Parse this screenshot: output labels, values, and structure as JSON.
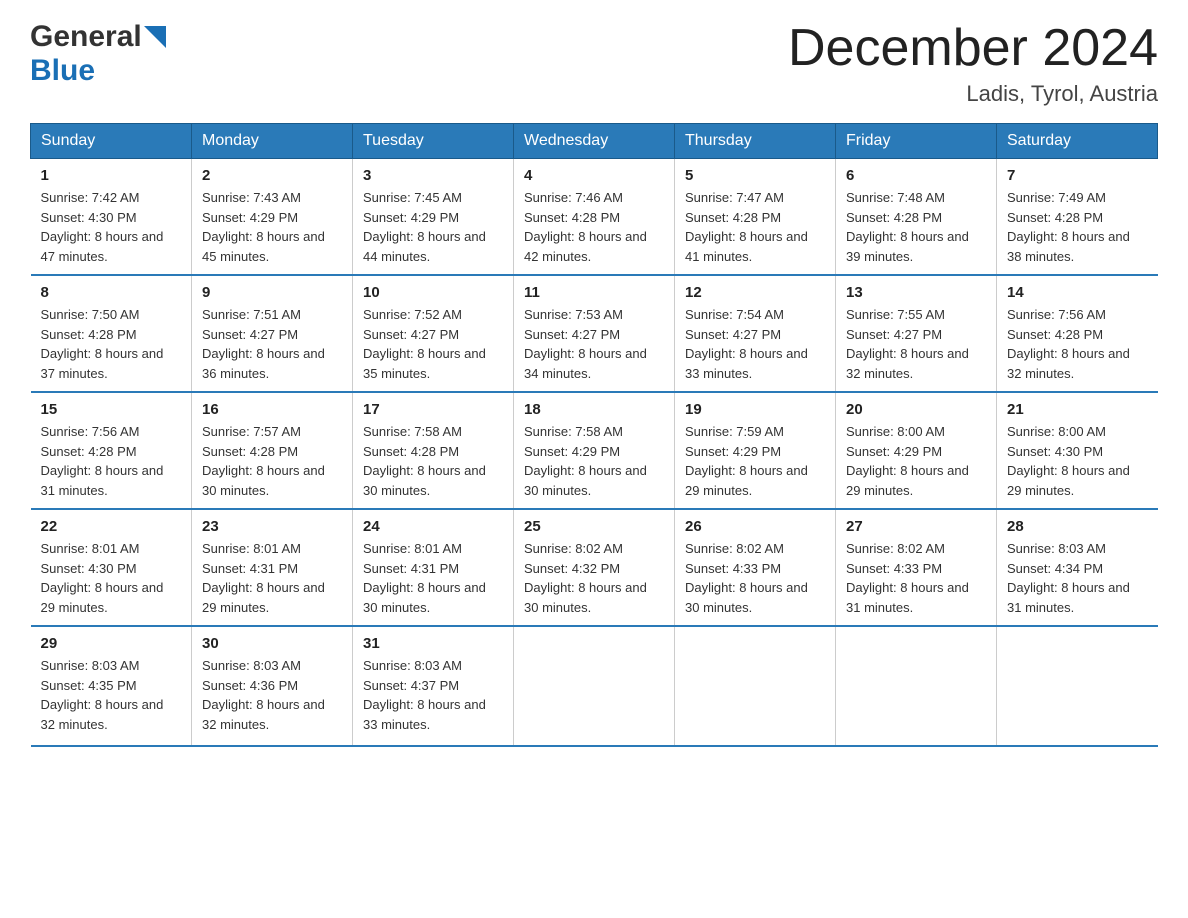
{
  "logo": {
    "general": "General",
    "blue": "Blue"
  },
  "title": "December 2024",
  "subtitle": "Ladis, Tyrol, Austria",
  "weekdays": [
    "Sunday",
    "Monday",
    "Tuesday",
    "Wednesday",
    "Thursday",
    "Friday",
    "Saturday"
  ],
  "weeks": [
    [
      {
        "day": "1",
        "sunrise": "7:42 AM",
        "sunset": "4:30 PM",
        "daylight": "8 hours and 47 minutes."
      },
      {
        "day": "2",
        "sunrise": "7:43 AM",
        "sunset": "4:29 PM",
        "daylight": "8 hours and 45 minutes."
      },
      {
        "day": "3",
        "sunrise": "7:45 AM",
        "sunset": "4:29 PM",
        "daylight": "8 hours and 44 minutes."
      },
      {
        "day": "4",
        "sunrise": "7:46 AM",
        "sunset": "4:28 PM",
        "daylight": "8 hours and 42 minutes."
      },
      {
        "day": "5",
        "sunrise": "7:47 AM",
        "sunset": "4:28 PM",
        "daylight": "8 hours and 41 minutes."
      },
      {
        "day": "6",
        "sunrise": "7:48 AM",
        "sunset": "4:28 PM",
        "daylight": "8 hours and 39 minutes."
      },
      {
        "day": "7",
        "sunrise": "7:49 AM",
        "sunset": "4:28 PM",
        "daylight": "8 hours and 38 minutes."
      }
    ],
    [
      {
        "day": "8",
        "sunrise": "7:50 AM",
        "sunset": "4:28 PM",
        "daylight": "8 hours and 37 minutes."
      },
      {
        "day": "9",
        "sunrise": "7:51 AM",
        "sunset": "4:27 PM",
        "daylight": "8 hours and 36 minutes."
      },
      {
        "day": "10",
        "sunrise": "7:52 AM",
        "sunset": "4:27 PM",
        "daylight": "8 hours and 35 minutes."
      },
      {
        "day": "11",
        "sunrise": "7:53 AM",
        "sunset": "4:27 PM",
        "daylight": "8 hours and 34 minutes."
      },
      {
        "day": "12",
        "sunrise": "7:54 AM",
        "sunset": "4:27 PM",
        "daylight": "8 hours and 33 minutes."
      },
      {
        "day": "13",
        "sunrise": "7:55 AM",
        "sunset": "4:27 PM",
        "daylight": "8 hours and 32 minutes."
      },
      {
        "day": "14",
        "sunrise": "7:56 AM",
        "sunset": "4:28 PM",
        "daylight": "8 hours and 32 minutes."
      }
    ],
    [
      {
        "day": "15",
        "sunrise": "7:56 AM",
        "sunset": "4:28 PM",
        "daylight": "8 hours and 31 minutes."
      },
      {
        "day": "16",
        "sunrise": "7:57 AM",
        "sunset": "4:28 PM",
        "daylight": "8 hours and 30 minutes."
      },
      {
        "day": "17",
        "sunrise": "7:58 AM",
        "sunset": "4:28 PM",
        "daylight": "8 hours and 30 minutes."
      },
      {
        "day": "18",
        "sunrise": "7:58 AM",
        "sunset": "4:29 PM",
        "daylight": "8 hours and 30 minutes."
      },
      {
        "day": "19",
        "sunrise": "7:59 AM",
        "sunset": "4:29 PM",
        "daylight": "8 hours and 29 minutes."
      },
      {
        "day": "20",
        "sunrise": "8:00 AM",
        "sunset": "4:29 PM",
        "daylight": "8 hours and 29 minutes."
      },
      {
        "day": "21",
        "sunrise": "8:00 AM",
        "sunset": "4:30 PM",
        "daylight": "8 hours and 29 minutes."
      }
    ],
    [
      {
        "day": "22",
        "sunrise": "8:01 AM",
        "sunset": "4:30 PM",
        "daylight": "8 hours and 29 minutes."
      },
      {
        "day": "23",
        "sunrise": "8:01 AM",
        "sunset": "4:31 PM",
        "daylight": "8 hours and 29 minutes."
      },
      {
        "day": "24",
        "sunrise": "8:01 AM",
        "sunset": "4:31 PM",
        "daylight": "8 hours and 30 minutes."
      },
      {
        "day": "25",
        "sunrise": "8:02 AM",
        "sunset": "4:32 PM",
        "daylight": "8 hours and 30 minutes."
      },
      {
        "day": "26",
        "sunrise": "8:02 AM",
        "sunset": "4:33 PM",
        "daylight": "8 hours and 30 minutes."
      },
      {
        "day": "27",
        "sunrise": "8:02 AM",
        "sunset": "4:33 PM",
        "daylight": "8 hours and 31 minutes."
      },
      {
        "day": "28",
        "sunrise": "8:03 AM",
        "sunset": "4:34 PM",
        "daylight": "8 hours and 31 minutes."
      }
    ],
    [
      {
        "day": "29",
        "sunrise": "8:03 AM",
        "sunset": "4:35 PM",
        "daylight": "8 hours and 32 minutes."
      },
      {
        "day": "30",
        "sunrise": "8:03 AM",
        "sunset": "4:36 PM",
        "daylight": "8 hours and 32 minutes."
      },
      {
        "day": "31",
        "sunrise": "8:03 AM",
        "sunset": "4:37 PM",
        "daylight": "8 hours and 33 minutes."
      },
      null,
      null,
      null,
      null
    ]
  ]
}
